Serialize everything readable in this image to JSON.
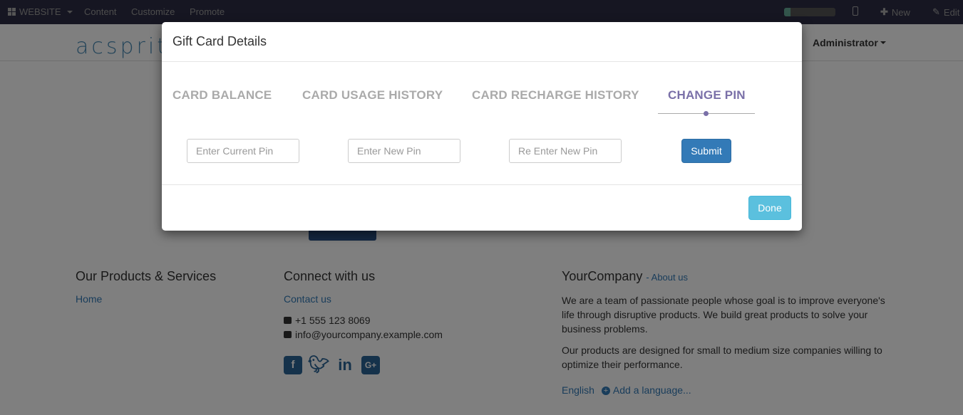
{
  "topbar": {
    "website_label": "WEBSITE",
    "content_label": "Content",
    "customize_label": "Customize",
    "promote_label": "Promote",
    "new_label": "New",
    "edit_label": "Edit"
  },
  "header": {
    "logo_text": "acsprit",
    "admin_label": "Administrator"
  },
  "footer": {
    "products_title": "Our Products & Services",
    "home_link": "Home",
    "connect_title": "Connect with us",
    "contact_link": "Contact us",
    "phone": "+1 555 123 8069",
    "email": "info@yourcompany.example.com",
    "company_name": "YourCompany",
    "about_link": "- About us",
    "about_text_1": "We are a team of passionate people whose goal is to improve everyone's life through disruptive products. We build great products to solve your business problems.",
    "about_text_2": "Our products are designed for small to medium size companies willing to optimize their performance.",
    "language": "English",
    "add_language": "Add a language..."
  },
  "modal": {
    "title": "Gift Card Details",
    "tabs": [
      {
        "label": "CARD BALANCE"
      },
      {
        "label": "CARD USAGE HISTORY"
      },
      {
        "label": "CARD RECHARGE HISTORY"
      },
      {
        "label": "CHANGE PIN"
      }
    ],
    "current_pin_placeholder": "Enter Current Pin",
    "new_pin_placeholder": "Enter New Pin",
    "reenter_pin_placeholder": "Re Enter New Pin",
    "submit_label": "Submit",
    "done_label": "Done"
  },
  "colors": {
    "active_tab": "#7a70a8",
    "primary": "#337ab7",
    "info": "#5bc0de"
  }
}
